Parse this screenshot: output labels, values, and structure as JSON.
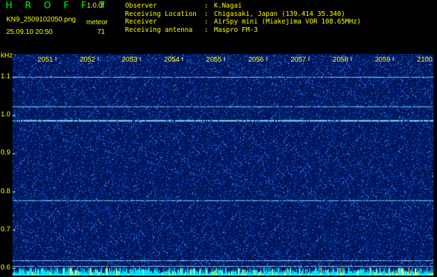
{
  "header": {
    "app_title": "HROFFT",
    "version": "1.0.0f",
    "filename": "KN9_2509102050.png",
    "datetime": "25.09.10 20:50",
    "meteor_label": "meteor",
    "meteor_count": "71"
  },
  "info": [
    {
      "key": "Observer",
      "sep": ":",
      "value": "K.Nagai"
    },
    {
      "key": "Receiving Location",
      "sep": ":",
      "value": "Chigasaki, Japan (139.414 35.340)"
    },
    {
      "key": "Receiver",
      "sep": ":",
      "value": "AirSpy mini (Miakejima VOR 108.65MHz)"
    },
    {
      "key": "Receiving antenna",
      "sep": ":",
      "value": "Maspro FM-3"
    }
  ],
  "chart_data": {
    "type": "heatmap",
    "ylabel": "kHz",
    "ylim": [
      0.58,
      1.16
    ],
    "yticks": [
      "1.1",
      "1.0",
      "0.9",
      "0.8",
      "0.7",
      "0.6"
    ],
    "xticks": [
      "2051",
      "2052",
      "2053",
      "2054",
      "2055",
      "2056",
      "2057",
      "2058",
      "2059",
      "2100"
    ],
    "signal_lines_khz": [
      1.1,
      1.023,
      0.987,
      0.777,
      0.62,
      0.605
    ],
    "colors": {
      "background": "#06106a",
      "noise": "#2b4cff",
      "signal": "#7fe8ff",
      "meteor": "#00e5ff",
      "labels": "#ffff00"
    }
  }
}
